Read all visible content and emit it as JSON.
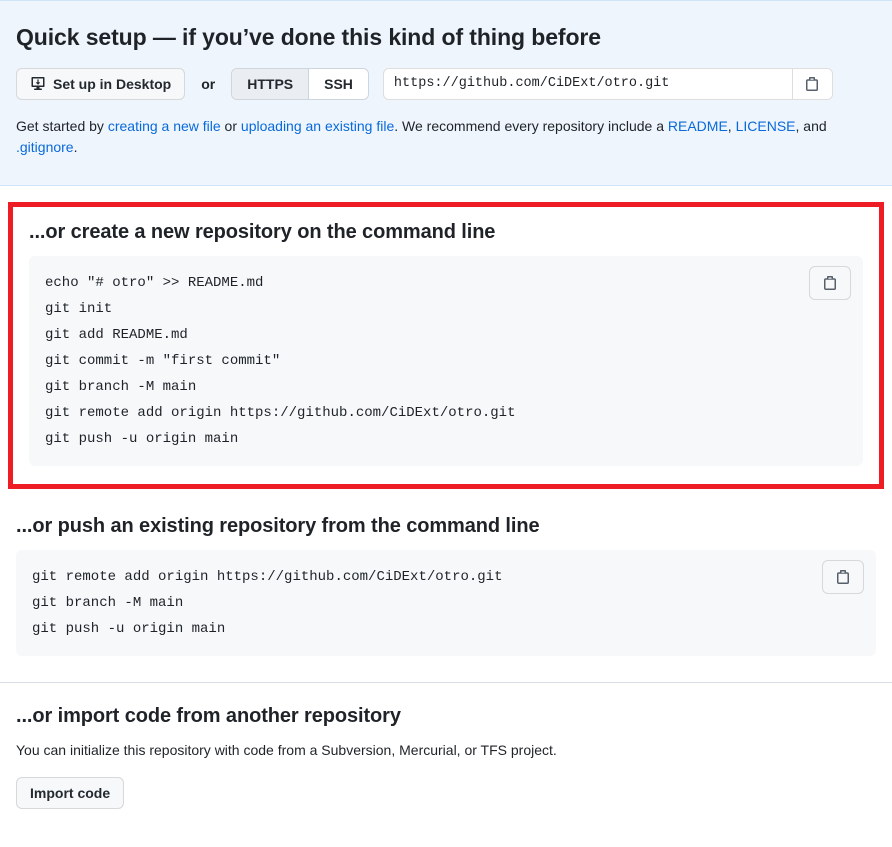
{
  "quick_setup": {
    "title": "Quick setup — if you’ve done this kind of thing before",
    "desktop_button": "Set up in Desktop",
    "or_word": "or",
    "protocols": [
      {
        "label": "HTTPS",
        "active": true
      },
      {
        "label": "SSH",
        "active": false
      }
    ],
    "clone_url": "https://github.com/CiDExt/otro.git",
    "clone_url_placeholder": "https://github.com/CiDExt/otro.git",
    "description": {
      "part1": "Get started by ",
      "link_new_file": "creating a new file",
      "part2": " or ",
      "link_upload": "uploading an existing file",
      "part3": ". We recommend every repository include a ",
      "link_readme": "README",
      "part4": ", ",
      "link_license": "LICENSE",
      "part5": ", and ",
      "link_gitignore": ".gitignore",
      "part6": "."
    }
  },
  "create_repo": {
    "title": "...or create a new repository on the command line",
    "commands": [
      "echo \"# otro\" >> README.md",
      "git init",
      "git add README.md",
      "git commit -m \"first commit\"",
      "git branch -M main",
      "git remote add origin https://github.com/CiDExt/otro.git",
      "git push -u origin main"
    ],
    "highlighted": true,
    "highlight_color": "#ee1c25"
  },
  "push_existing": {
    "title": "...or push an existing repository from the command line",
    "commands": [
      "git remote add origin https://github.com/CiDExt/otro.git",
      "git branch -M main",
      "git push -u origin main"
    ]
  },
  "import_code": {
    "title": "...or import code from another repository",
    "description": "You can initialize this repository with code from a Subversion, Mercurial, or TFS project.",
    "button": "Import code"
  },
  "colors": {
    "panel_bg": "#eef5fd",
    "code_bg": "#f6f8fa",
    "link": "#0969da",
    "text": "#1f2328",
    "highlight": "#ee1c25"
  }
}
